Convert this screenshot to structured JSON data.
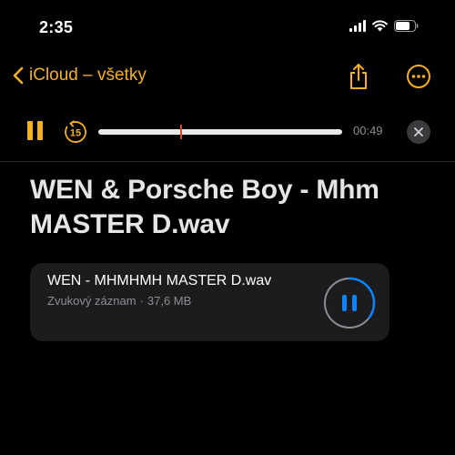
{
  "status_bar": {
    "time": "2:35",
    "icons": [
      "cellular-signal-icon",
      "wifi-icon",
      "battery-icon"
    ]
  },
  "nav": {
    "back_label": "iCloud – všetky",
    "actions": [
      "share-icon",
      "more-icon"
    ]
  },
  "player": {
    "elapsed": "00:49",
    "skip_back_seconds": "15",
    "is_playing": true,
    "progress_fraction": 0.34
  },
  "document": {
    "title": "WEN & Porsche Boy - Mhm MASTER D.wav"
  },
  "attachment": {
    "name": "WEN - MHMHMH MASTER D.wav",
    "type": "Zvukový záznam",
    "separator": "·",
    "size": "37,6 MB",
    "progress_fraction": 0.35
  },
  "colors": {
    "accent": "#f5b023",
    "playhead": "#e0442b",
    "attachment_accent": "#0a84ff",
    "card_background": "#1c1c1e",
    "secondary_text": "#8e8e93"
  }
}
